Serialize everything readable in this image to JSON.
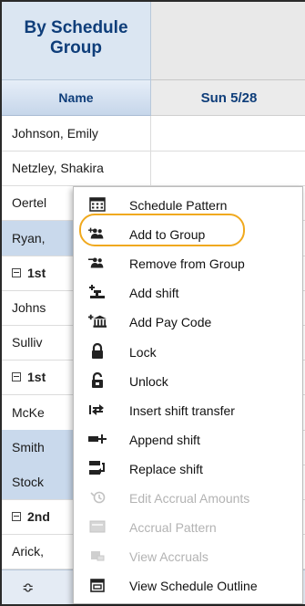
{
  "panel": {
    "title_line1": "By Schedule",
    "title_line2": "Group",
    "name_column_header": "Name",
    "day_column_header": "Sun 5/28"
  },
  "rows": [
    {
      "name": "Johnson, Emily",
      "type": "person",
      "selected": false
    },
    {
      "name": "Netzley, Shakira",
      "type": "person",
      "selected": false
    },
    {
      "name": "Oertel",
      "type": "person",
      "selected": false
    },
    {
      "name": "Ryan,",
      "type": "person",
      "selected": true
    },
    {
      "name": "1st",
      "type": "group",
      "selected": false
    },
    {
      "name": "Johns",
      "type": "person",
      "selected": false
    },
    {
      "name": "Sulliv",
      "type": "person",
      "selected": false
    },
    {
      "name": "1st",
      "type": "group",
      "selected": false
    },
    {
      "name": "McKe",
      "type": "person",
      "selected": false
    },
    {
      "name": "Smith",
      "type": "person",
      "selected": true
    },
    {
      "name": "Stock",
      "type": "person",
      "selected": true
    },
    {
      "name": "2nd",
      "type": "group",
      "selected": false
    },
    {
      "name": "Arick,",
      "type": "person",
      "selected": false
    }
  ],
  "footer": {
    "sort_icon": "sort-updown-icon",
    "sort_glyph": "≎"
  },
  "context_menu": {
    "highlight_color": "#f0a91e",
    "items": [
      {
        "label": "Schedule Pattern",
        "icon": "calendar-grid-icon",
        "enabled": true
      },
      {
        "label": "Add to Group",
        "icon": "add-group-icon",
        "enabled": true,
        "highlighted": true
      },
      {
        "label": "Remove from Group",
        "icon": "remove-group-icon",
        "enabled": true
      },
      {
        "label": "Add shift",
        "icon": "add-shift-icon",
        "enabled": true
      },
      {
        "label": "Add Pay Code",
        "icon": "add-paycode-icon",
        "enabled": true
      },
      {
        "label": "Lock",
        "icon": "lock-icon",
        "enabled": true
      },
      {
        "label": "Unlock",
        "icon": "unlock-icon",
        "enabled": true
      },
      {
        "label": "Insert shift transfer",
        "icon": "shift-transfer-icon",
        "enabled": true
      },
      {
        "label": "Append shift",
        "icon": "append-shift-icon",
        "enabled": true
      },
      {
        "label": "Replace shift",
        "icon": "replace-shift-icon",
        "enabled": true
      },
      {
        "label": "Edit Accrual Amounts",
        "icon": "edit-accrual-icon",
        "enabled": false
      },
      {
        "label": "Accrual Pattern",
        "icon": "accrual-pattern-icon",
        "enabled": false
      },
      {
        "label": "View Accruals",
        "icon": "view-accruals-icon",
        "enabled": false
      },
      {
        "label": "View Schedule Outline",
        "icon": "schedule-outline-icon",
        "enabled": true
      }
    ]
  }
}
